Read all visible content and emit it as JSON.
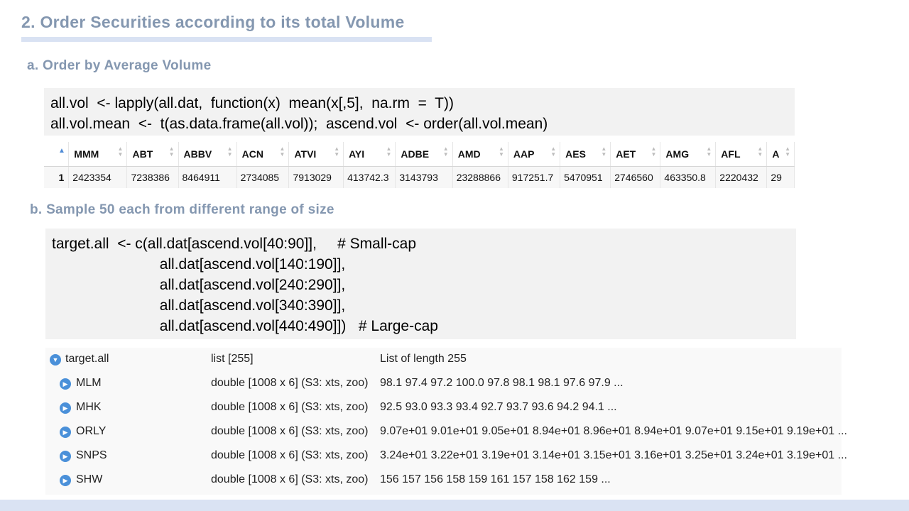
{
  "section_title": "2. Order Securities according to its total Volume",
  "sub_a": "a. Order by Average Volume",
  "code_a": [
    "all.vol  <- lapply(all.dat,  function(x)  mean(x[,5],  na.rm  =  T))",
    "all.vol.mean  <-  t(as.data.frame(all.vol));  ascend.vol  <- order(all.vol.mean)"
  ],
  "table": {
    "headers": [
      "MMM",
      "ABT",
      "ABBV",
      "ACN",
      "ATVI",
      "AYI",
      "ADBE",
      "AMD",
      "AAP",
      "AES",
      "AET",
      "AMG",
      "AFL",
      "A"
    ],
    "row_index": "1",
    "values": [
      "2423354",
      "7238386",
      "8464911",
      "2734085",
      "7913029",
      "413742.3",
      "3143793",
      "23288866",
      "917251.7",
      "5470951",
      "2746560",
      "463350.8",
      "2220432",
      "29"
    ]
  },
  "sub_b": "b. Sample 50 each from different range of size",
  "code_b": [
    "target.all  <- c(all.dat[ascend.vol[40:90]],     # Small-cap",
    "                          all.dat[ascend.vol[140:190]],",
    "                          all.dat[ascend.vol[240:290]],",
    "                          all.dat[ascend.vol[340:390]],",
    "                          all.dat[ascend.vol[440:490]])   # Large-cap"
  ],
  "env": [
    {
      "name": "target.all",
      "type": "list [255]",
      "value": "List of length 255",
      "icon": "collapse-icon"
    },
    {
      "name": "MLM",
      "type": "double [1008 x 6] (S3: xts, zoo)",
      "value": "98.1 97.4 97.2 100.0 97.8 98.1 98.1 97.6 97.9 ...",
      "icon": "expand-icon"
    },
    {
      "name": "MHK",
      "type": "double [1008 x 6] (S3: xts, zoo)",
      "value": "92.5 93.0 93.3 93.4 92.7 93.7 93.6 94.2 94.1 ...",
      "icon": "expand-icon"
    },
    {
      "name": "ORLY",
      "type": "double [1008 x 6] (S3: xts, zoo)",
      "value": "9.07e+01 9.01e+01 9.05e+01 8.94e+01 8.96e+01 8.94e+01 9.07e+01 9.15e+01 9.19e+01 ...",
      "icon": "expand-icon"
    },
    {
      "name": "SNPS",
      "type": "double [1008 x 6] (S3: xts, zoo)",
      "value": "3.24e+01 3.22e+01 3.19e+01 3.14e+01 3.15e+01 3.16e+01 3.25e+01 3.24e+01 3.19e+01 ...",
      "icon": "expand-icon"
    },
    {
      "name": "SHW",
      "type": "double [1008 x 6] (S3: xts, zoo)",
      "value": "156 157 156 158 159 161 157 158 162 159 ...",
      "icon": "expand-icon"
    }
  ]
}
